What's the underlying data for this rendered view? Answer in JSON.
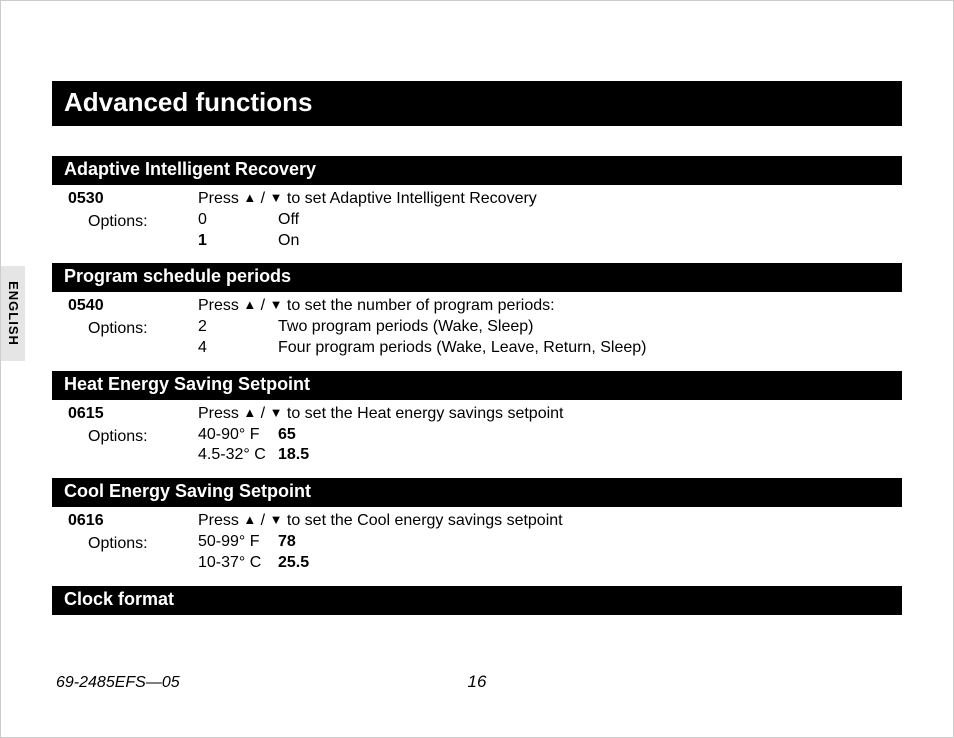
{
  "language_tab": "ENGLISH",
  "page_title": "Advanced functions",
  "triangle_up": "▲",
  "triangle_down": "▼",
  "slash": " / ",
  "sections": [
    {
      "header": "Adaptive Intelligent Recovery",
      "code": "0530",
      "options_label": "Options:",
      "press_prefix": "Press ",
      "press_suffix": " to set Adaptive Intelligent Recovery",
      "opts": [
        {
          "key": "0",
          "key_bold": false,
          "text": "Off"
        },
        {
          "key": "1",
          "key_bold": true,
          "text": "On"
        }
      ]
    },
    {
      "header": "Program schedule periods",
      "code": "0540",
      "options_label": "Options:",
      "press_prefix": "Press ",
      "press_suffix": " to set the number of program periods:",
      "opts": [
        {
          "key": "2",
          "key_bold": false,
          "text": "Two program periods (Wake, Sleep)"
        },
        {
          "key": "4",
          "key_bold": false,
          "text": "Four program periods (Wake, Leave, Return, Sleep)"
        }
      ]
    },
    {
      "header": "Heat Energy Saving Setpoint",
      "code": "0615",
      "options_label": "Options:",
      "press_prefix": "Press ",
      "press_suffix": " to set the Heat energy savings setpoint",
      "opts": [
        {
          "key": "40-90° F",
          "key_bold": false,
          "text_bold": true,
          "text": "65"
        },
        {
          "key": "4.5-32° C",
          "key_bold": false,
          "text_bold": true,
          "text": "18.5"
        }
      ]
    },
    {
      "header": "Cool Energy Saving Setpoint",
      "code": "0616",
      "options_label": "Options:",
      "press_prefix": "Press ",
      "press_suffix": " to set the Cool energy savings setpoint",
      "opts": [
        {
          "key": "50-99° F",
          "key_bold": false,
          "text_bold": true,
          "text": "78"
        },
        {
          "key": "10-37° C",
          "key_bold": false,
          "text_bold": true,
          "text": "25.5"
        }
      ]
    },
    {
      "header": "Clock format",
      "no_body": true
    }
  ],
  "footer": {
    "docnum": "69-2485EFS—05",
    "pagenum": "16"
  }
}
